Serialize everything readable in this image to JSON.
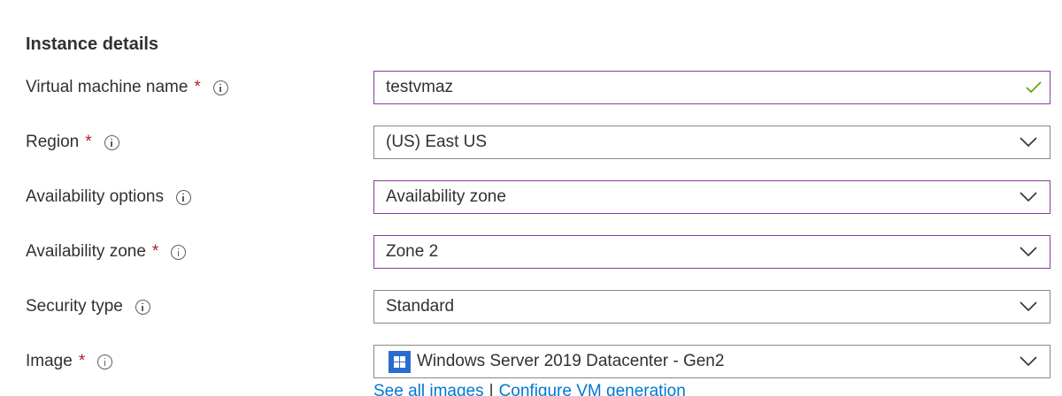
{
  "section": {
    "title": "Instance details"
  },
  "fields": {
    "vm_name": {
      "label": "Virtual machine name",
      "required_mark": "*",
      "value": "testvmaz"
    },
    "region": {
      "label": "Region",
      "required_mark": "*",
      "value": "(US) East US"
    },
    "availability_options": {
      "label": "Availability options",
      "value": "Availability zone"
    },
    "availability_zone": {
      "label": "Availability zone",
      "required_mark": "*",
      "value": "Zone 2"
    },
    "security_type": {
      "label": "Security type",
      "value": "Standard"
    },
    "image": {
      "label": "Image",
      "required_mark": "*",
      "value": "Windows Server 2019 Datacenter - Gen2",
      "icon": "windows-logo-icon"
    }
  },
  "links": {
    "see_all_images": "See all images",
    "separator": "|",
    "configure_vm_generation": "Configure VM generation"
  },
  "colors": {
    "accent_border": "#8a3d9a",
    "valid_check": "#57a300",
    "required": "#a4262c",
    "link": "#0078d4",
    "windows_logo": "#2b6cd1"
  }
}
